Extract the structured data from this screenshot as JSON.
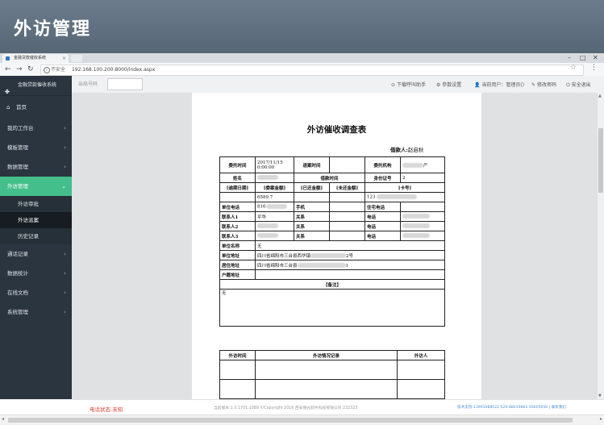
{
  "page_heading": "外访管理",
  "browser": {
    "tab_title": "金融贷款催收系统",
    "insecure_label": "不安全",
    "url": "192.168.100.200:8000/index.aspx"
  },
  "app": {
    "name": "金融贷款催收系统",
    "home": "首页",
    "sidebar": [
      {
        "label": "我的工作台"
      },
      {
        "label": "模板管理"
      },
      {
        "label": "数据管理"
      },
      {
        "label": "外访管理"
      },
      {
        "label": "通话记录"
      },
      {
        "label": "数据统计"
      },
      {
        "label": "在线文档"
      },
      {
        "label": "系统管理"
      }
    ],
    "submenu": [
      {
        "label": "外访审批"
      },
      {
        "label": "外访派案"
      },
      {
        "label": "历史记录"
      }
    ]
  },
  "toolbar": {
    "ext_label": "出局号码",
    "download": "下载呼叫助手",
    "settings": "参数设置",
    "user": "当前用户：管理员()",
    "change_password": "修改密码",
    "logout": "安全退出"
  },
  "form": {
    "title": "外访催收调查表",
    "borrower_label": "借款人:",
    "borrower_value": "赵启秋",
    "row1": {
      "entrust_time": "委托时间",
      "entrust_time_val": "2017/11/15 0:00:00",
      "return_time": "退案时间",
      "agency": "委托机构",
      "agency_val": "产"
    },
    "row2": {
      "name": "姓名",
      "loan_time": "借款时间",
      "id_no": "身份证号",
      "id_val": "2"
    },
    "row3": {
      "overdue_days": "[逾期日期]",
      "case_amount": "[委案金额]",
      "paid": "[已还金额]",
      "unpaid": "[未还金额]",
      "card": "[卡号]"
    },
    "row4": {
      "case_amount_val": "6589.7",
      "card_val": "123"
    },
    "unit_phone": "单位电话",
    "unit_phone_val": "816",
    "mobile": "手机",
    "home_phone": "住宅电话",
    "contact1": "联系人1",
    "contact1_name": "平华",
    "relation": "关系",
    "phone": "电话",
    "contact2": "联系人2",
    "contact3": "联系人3",
    "unit_name": "单位名称",
    "unit_name_val": "无",
    "unit_addr": "单位地址",
    "unit_addr_val": "四川省绵阳市三台县西华镇",
    "unit_addr_suffix": "2号",
    "home_addr": "居住地址",
    "home_addr_val": "四川省绵阳市三台县",
    "home_addr_suffix": "1",
    "hukou_addr": "户籍地址",
    "remarks_label": "【备注】",
    "remarks_val": "无",
    "visit_time": "外访时间",
    "visit_record": "外访情况记录",
    "visitor": "外访人"
  },
  "footer": {
    "status": "电话状态:未知",
    "version": "当前版本:1.0.1701.1089 ©Copyright 2016 西安德光软件科技有限公司 232323",
    "support": "技术支持:13991988022 029-88019863 56605656 | 联系我们"
  }
}
